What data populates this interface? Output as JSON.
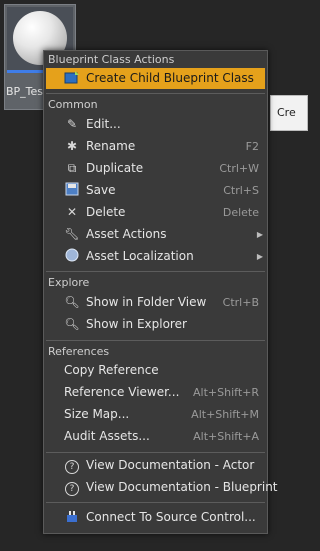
{
  "asset": {
    "name": "BP_TestActor"
  },
  "background_peek": {
    "text": "Cre"
  },
  "menu": {
    "sections": {
      "blueprint": "Blueprint Class Actions",
      "common": "Common",
      "explore": "Explore",
      "references": "References"
    },
    "items": {
      "create_child": {
        "label": "Create Child Blueprint Class"
      },
      "edit": {
        "label": "Edit..."
      },
      "rename": {
        "label": "Rename",
        "shortcut": "F2"
      },
      "duplicate": {
        "label": "Duplicate",
        "shortcut": "Ctrl+W"
      },
      "save": {
        "label": "Save",
        "shortcut": "Ctrl+S"
      },
      "delete": {
        "label": "Delete",
        "shortcut": "Delete"
      },
      "asset_actions": {
        "label": "Asset Actions"
      },
      "asset_localization": {
        "label": "Asset Localization"
      },
      "show_folder": {
        "label": "Show in Folder View",
        "shortcut": "Ctrl+B"
      },
      "show_explorer": {
        "label": "Show in Explorer"
      },
      "copy_reference": {
        "label": "Copy Reference"
      },
      "reference_viewer": {
        "label": "Reference Viewer...",
        "shortcut": "Alt+Shift+R"
      },
      "size_map": {
        "label": "Size Map...",
        "shortcut": "Alt+Shift+M"
      },
      "audit_assets": {
        "label": "Audit Assets...",
        "shortcut": "Alt+Shift+A"
      },
      "doc_actor": {
        "label": "View Documentation - Actor"
      },
      "doc_blueprint": {
        "label": "View Documentation - Blueprint"
      },
      "source_control": {
        "label": "Connect To Source Control..."
      }
    }
  },
  "colors": {
    "highlight": "#e5a11b",
    "menu_bg": "#3a3a3a",
    "accent_blue": "#3f7de8"
  }
}
